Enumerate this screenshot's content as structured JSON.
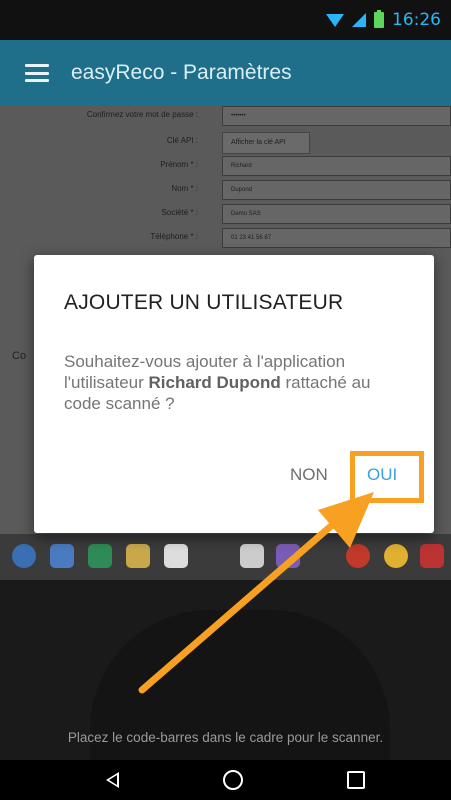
{
  "status_bar": {
    "time": "16:26",
    "icons": [
      "wifi-icon",
      "signal-icon",
      "battery-charging-icon"
    ]
  },
  "app_bar": {
    "title": "easyReco - Paramètres",
    "menu_icon": "hamburger-menu-icon"
  },
  "background_form": {
    "rows": [
      {
        "label": "Confirmez votre mot de passe :",
        "value": "•••••••"
      },
      {
        "label": "Clé API :",
        "value": "Afficher la clé API"
      },
      {
        "label": "Prénom * :",
        "value": "Richard"
      },
      {
        "label": "Nom * :",
        "value": "Dupond"
      },
      {
        "label": "Société * :",
        "value": "Demo SAS"
      },
      {
        "label": "Téléphone * :",
        "value": "01 23 41 56 87"
      }
    ],
    "side_label": "Co"
  },
  "dialog": {
    "title": "AJOUTER UN UTILISATEUR",
    "message_before": "Souhaitez-vous ajouter à l'application l'utilisateur ",
    "message_bold": "Richard Dupond",
    "message_after": " rattaché au code scanné ?",
    "cancel_label": "NON",
    "confirm_label": "OUI"
  },
  "scanner": {
    "hint": "Placez le code-barres dans le cadre pour le scanner."
  },
  "nav_bar": {
    "icons": [
      "back-icon",
      "home-icon",
      "recent-apps-icon"
    ]
  },
  "colors": {
    "app_bar": "#1f6f8b",
    "accent": "#3aa0d9",
    "highlight": "#f7a021"
  }
}
